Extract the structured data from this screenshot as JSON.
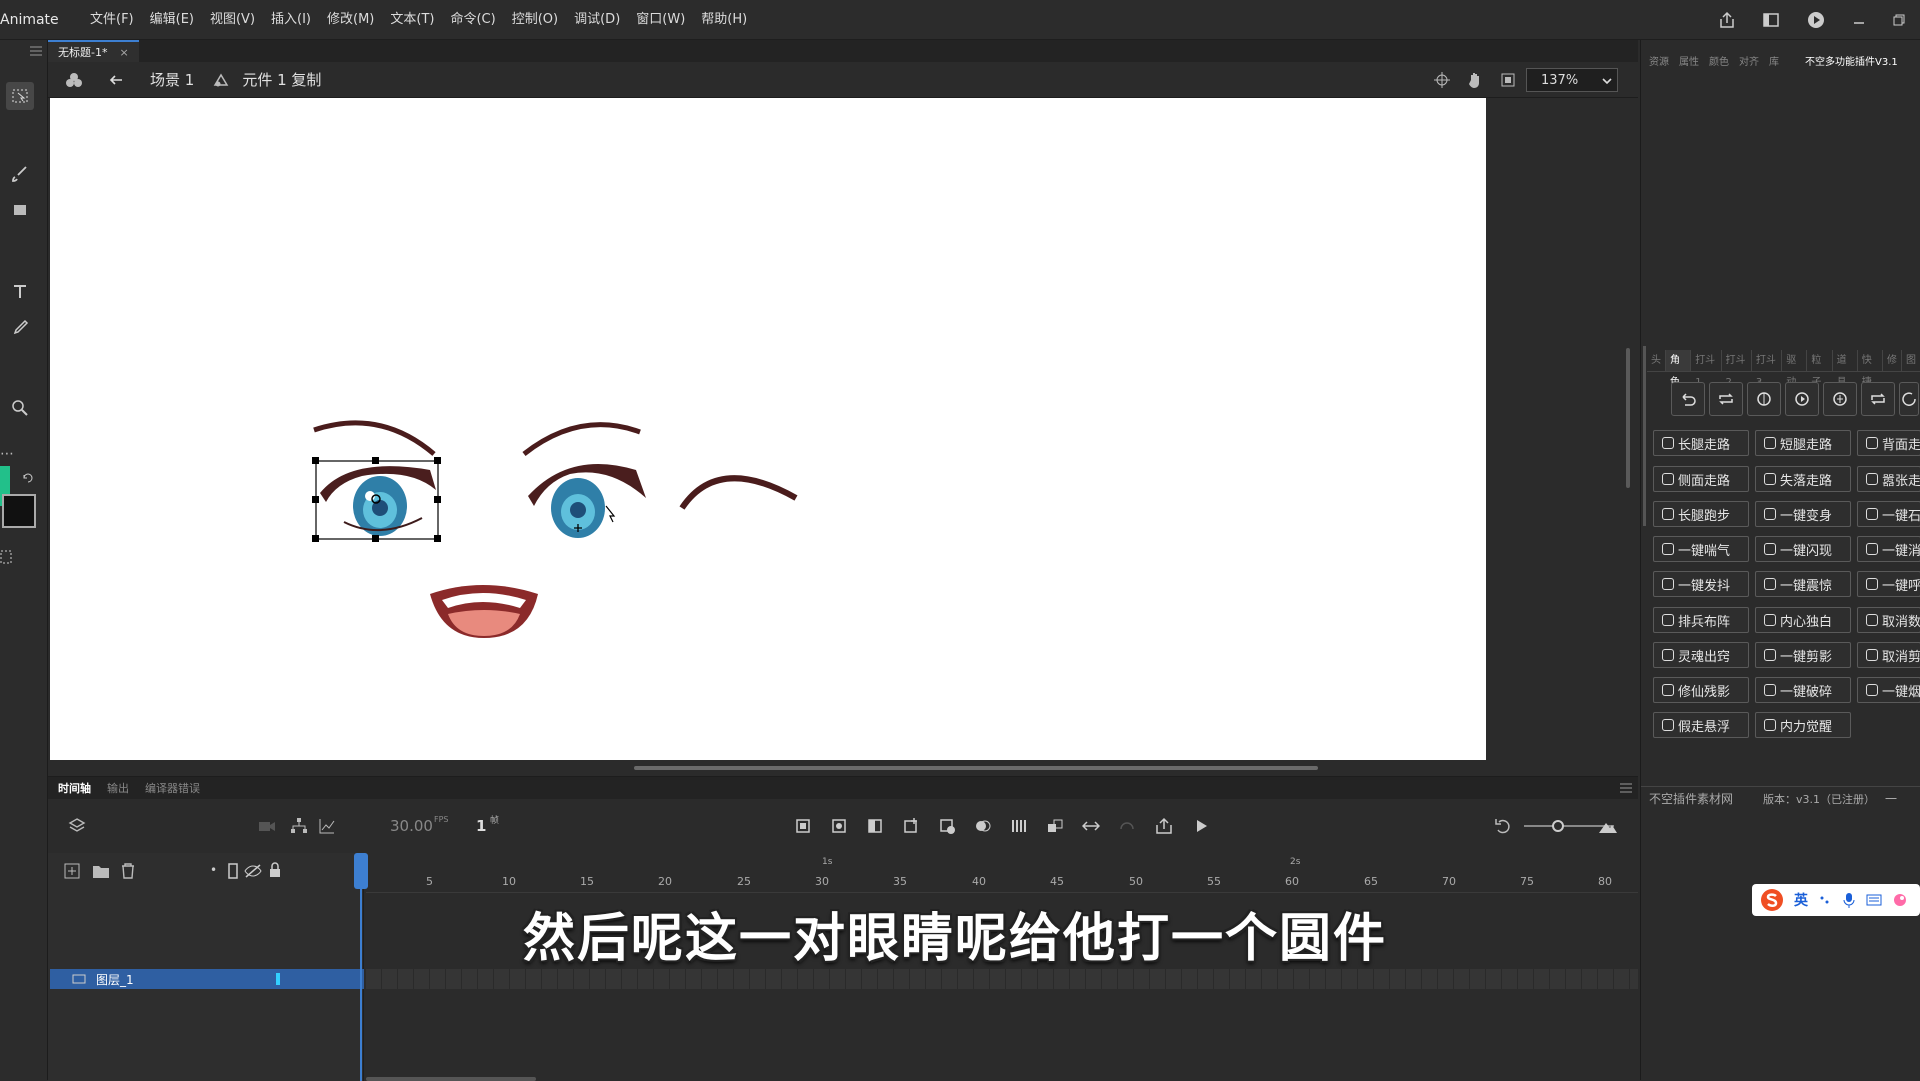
{
  "app": {
    "name": "Animate",
    "menu": [
      "文件(F)",
      "编辑(E)",
      "视图(V)",
      "插入(I)",
      "修改(M)",
      "文本(T)",
      "命令(C)",
      "控制(O)",
      "调试(D)",
      "窗口(W)",
      "帮助(H)"
    ]
  },
  "document": {
    "tab_title": "无标题-1*",
    "tab_close": "×",
    "crumb_scene": "场景 1",
    "crumb_symbol": "元件 1 复制",
    "zoom": "137%"
  },
  "timeline": {
    "tabs": [
      "时间轴",
      "输出",
      "编译器错误"
    ],
    "fps": "30.00",
    "fps_unit": "FPS",
    "frame": "1",
    "frame_unit": "帧",
    "layer_name": "图层_1",
    "ruler_seconds": [
      "1s",
      "2s"
    ],
    "ruler_ticks": [
      "5",
      "10",
      "15",
      "20",
      "25",
      "30",
      "35",
      "40",
      "45",
      "50",
      "55",
      "60",
      "65",
      "70",
      "75",
      "80"
    ]
  },
  "right_panel": {
    "tabs": [
      "资源",
      "属性",
      "颜色",
      "对齐",
      "库",
      "不空多功能插件V3.1"
    ],
    "category_tabs": [
      "头",
      "角色",
      "打斗1",
      "打斗2",
      "打斗3",
      "驱动",
      "粒子",
      "道具",
      "快捷",
      "修",
      "图"
    ],
    "buttons": [
      [
        "长腿走路",
        "短腿走路",
        "背面走"
      ],
      [
        "侧面走路",
        "失落走路",
        "嚣张走"
      ],
      [
        "长腿跑步",
        "一键变身",
        "一键石"
      ],
      [
        "一键喘气",
        "一键闪现",
        "一键消"
      ],
      [
        "一键发抖",
        "一键震惊",
        "一键呼"
      ],
      [
        "排兵布阵",
        "内心独白",
        "取消数"
      ],
      [
        "灵魂出窍",
        "一键剪影",
        "取消剪"
      ],
      [
        "修仙残影",
        "一键破碎",
        "一键烟"
      ],
      [
        "假走悬浮",
        "内力觉醒"
      ]
    ],
    "footer_left": "不空插件素材网",
    "footer_right": "版本：v3.1（已注册）",
    "footer_tail": "一"
  },
  "ime": {
    "label": "英"
  },
  "subtitle": "然后呢这一对眼睛呢给他打一个圆件",
  "colors": {
    "accent": "#3d7fd1",
    "fill_color": "#22c08a",
    "stroke_color": "#111111",
    "layer_highlight": "#2f5fa2"
  }
}
